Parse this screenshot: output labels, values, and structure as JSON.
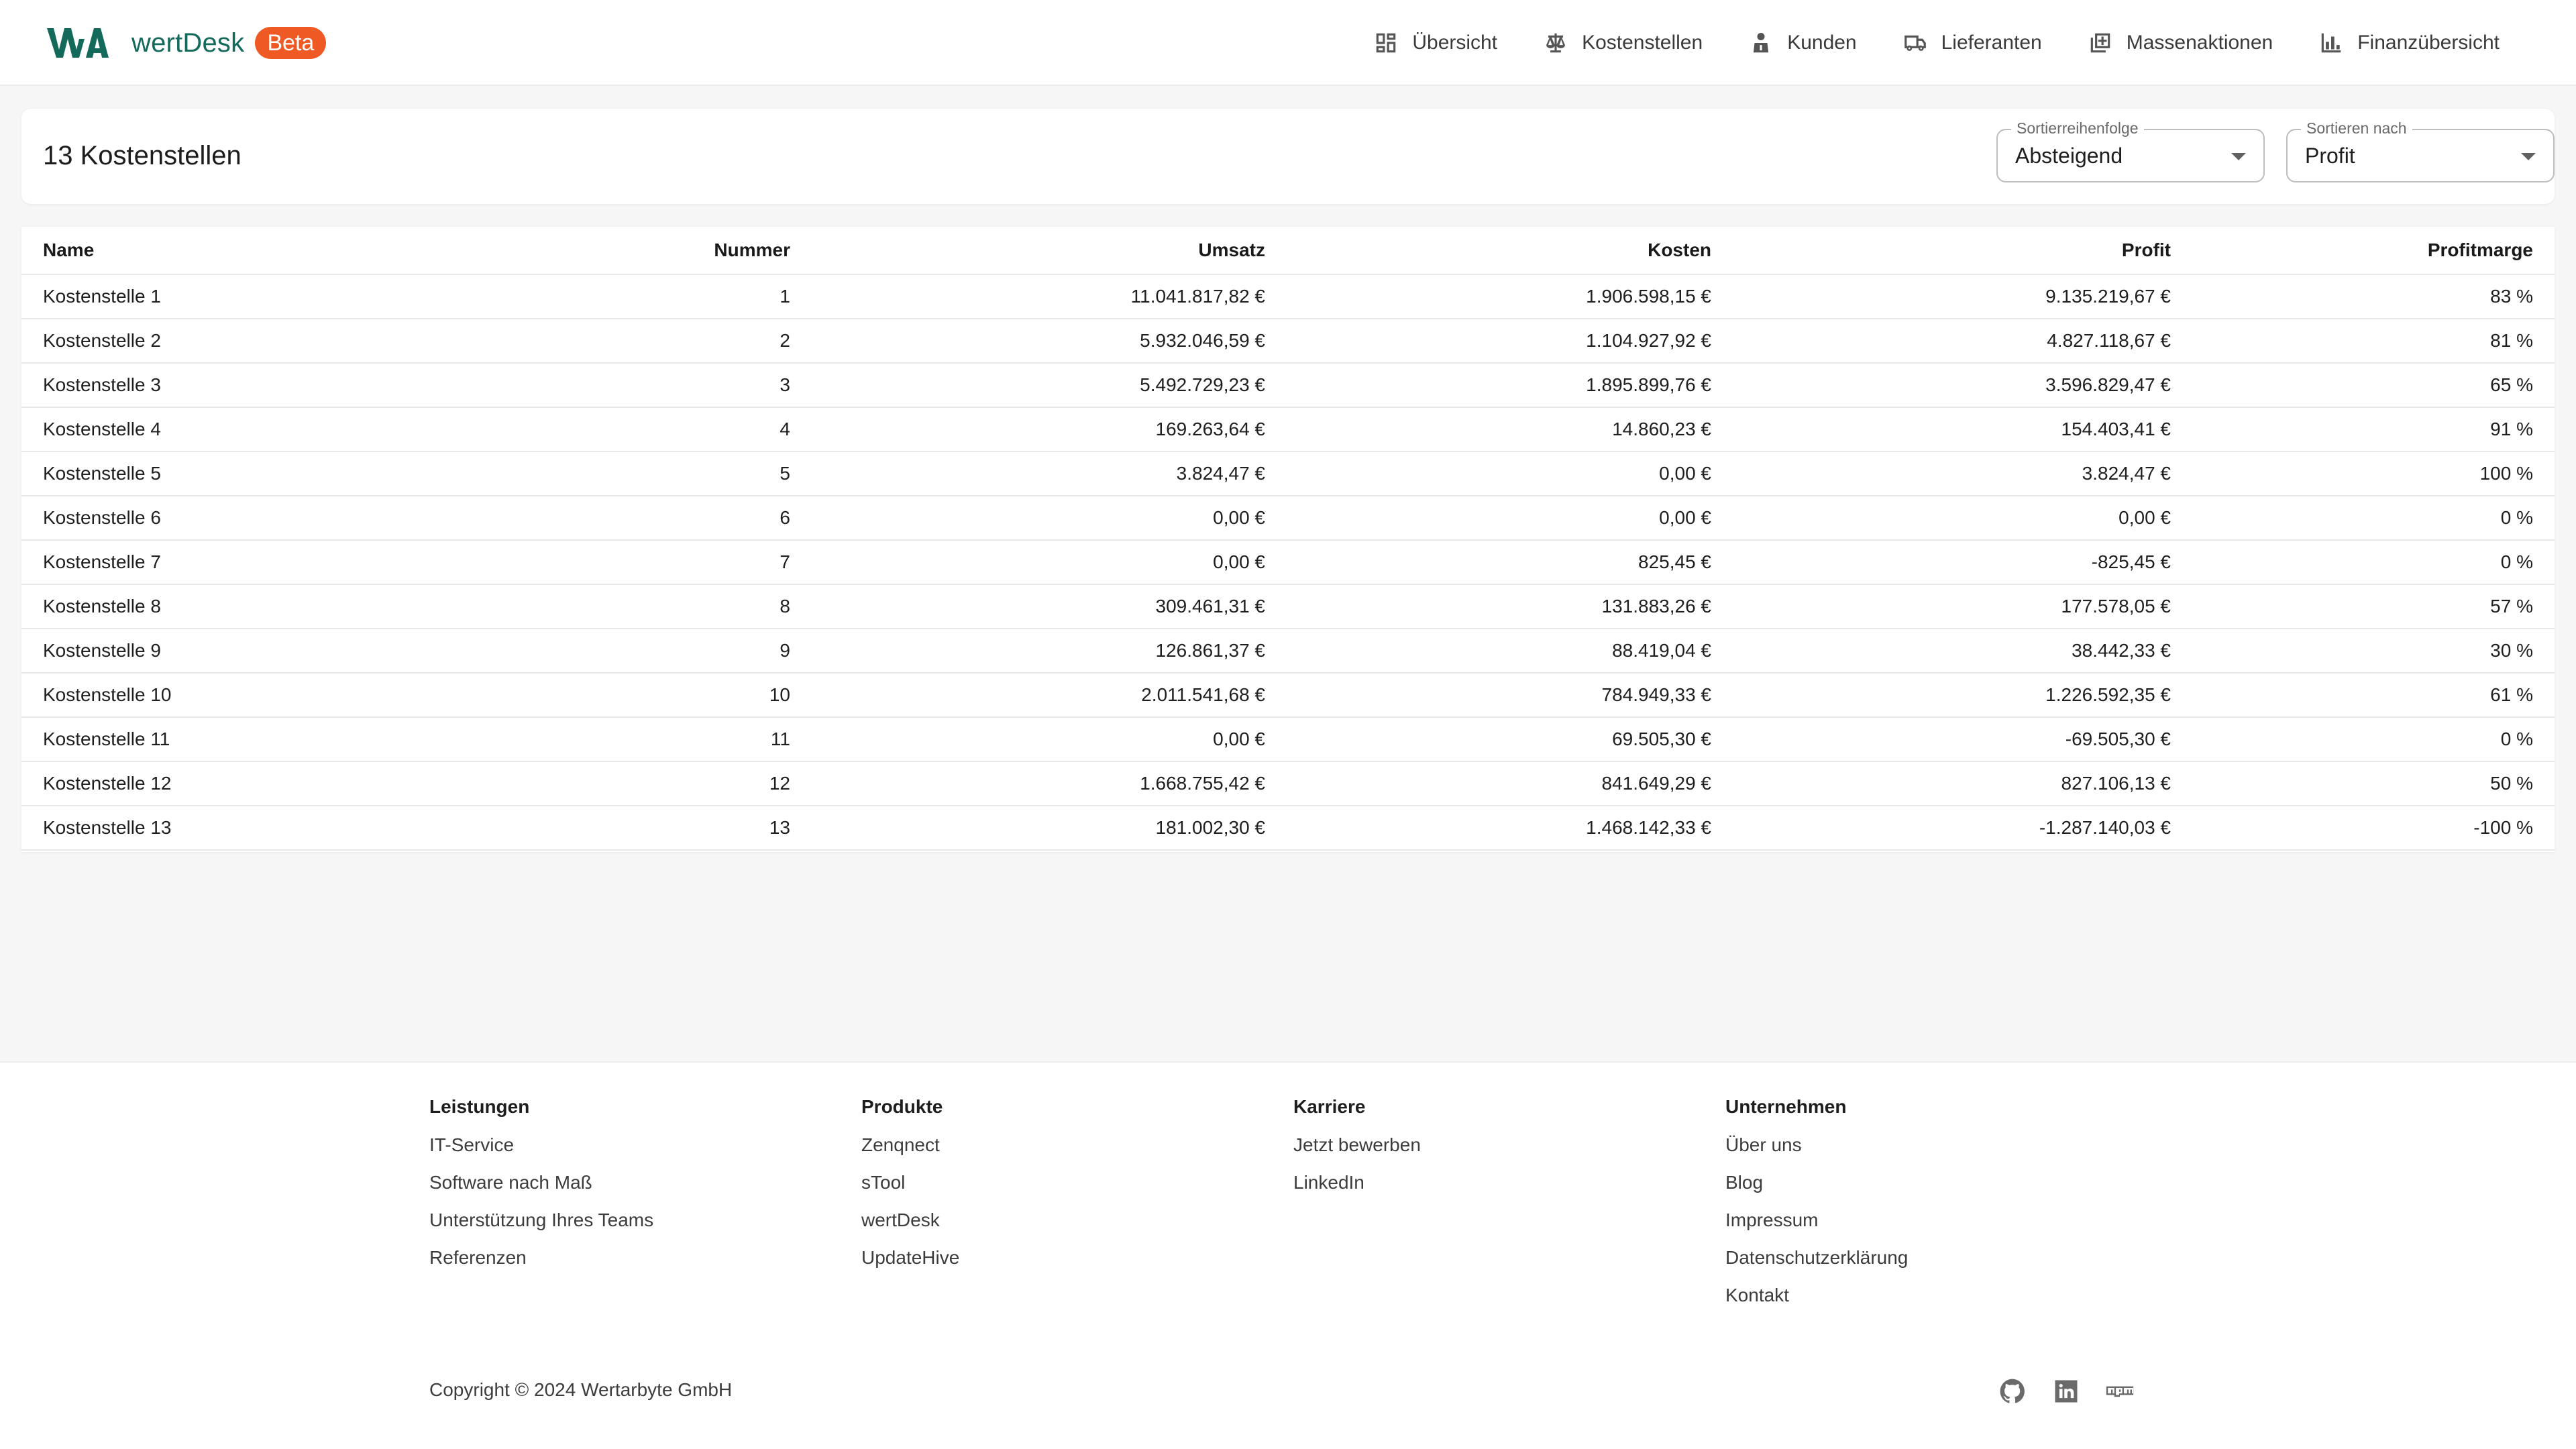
{
  "header": {
    "brand_name": "wertDesk",
    "beta_label": "Beta",
    "nav": [
      {
        "label": "Übersicht",
        "icon": "dashboard-icon"
      },
      {
        "label": "Kostenstellen",
        "icon": "scale-icon"
      },
      {
        "label": "Kunden",
        "icon": "person-icon"
      },
      {
        "label": "Lieferanten",
        "icon": "truck-icon"
      },
      {
        "label": "Massenaktionen",
        "icon": "add-box-icon"
      },
      {
        "label": "Finanzübersicht",
        "icon": "bar-chart-icon"
      }
    ]
  },
  "page": {
    "title": "13 Kostenstellen",
    "order_select": {
      "label": "Sortierreihenfolge",
      "value": "Absteigend"
    },
    "sort_select": {
      "label": "Sortieren nach",
      "value": "Profit"
    }
  },
  "table": {
    "headers": [
      "Name",
      "Nummer",
      "Umsatz",
      "Kosten",
      "Profit",
      "Profitmarge"
    ],
    "rows": [
      [
        "Kostenstelle 1",
        "1",
        "11.041.817,82 €",
        "1.906.598,15 €",
        "9.135.219,67 €",
        "83 %"
      ],
      [
        "Kostenstelle 2",
        "2",
        "5.932.046,59 €",
        "1.104.927,92 €",
        "4.827.118,67 €",
        "81 %"
      ],
      [
        "Kostenstelle 3",
        "3",
        "5.492.729,23 €",
        "1.895.899,76 €",
        "3.596.829,47 €",
        "65 %"
      ],
      [
        "Kostenstelle 4",
        "4",
        "169.263,64 €",
        "14.860,23 €",
        "154.403,41 €",
        "91 %"
      ],
      [
        "Kostenstelle 5",
        "5",
        "3.824,47 €",
        "0,00 €",
        "3.824,47 €",
        "100 %"
      ],
      [
        "Kostenstelle 6",
        "6",
        "0,00 €",
        "0,00 €",
        "0,00 €",
        "0 %"
      ],
      [
        "Kostenstelle 7",
        "7",
        "0,00 €",
        "825,45 €",
        "-825,45 €",
        "0 %"
      ],
      [
        "Kostenstelle 8",
        "8",
        "309.461,31 €",
        "131.883,26 €",
        "177.578,05 €",
        "57 %"
      ],
      [
        "Kostenstelle 9",
        "9",
        "126.861,37 €",
        "88.419,04 €",
        "38.442,33 €",
        "30 %"
      ],
      [
        "Kostenstelle 10",
        "10",
        "2.011.541,68 €",
        "784.949,33 €",
        "1.226.592,35 €",
        "61 %"
      ],
      [
        "Kostenstelle 11",
        "11",
        "0,00 €",
        "69.505,30 €",
        "-69.505,30 €",
        "0 %"
      ],
      [
        "Kostenstelle 12",
        "12",
        "1.668.755,42 €",
        "841.649,29 €",
        "827.106,13 €",
        "50 %"
      ],
      [
        "Kostenstelle 13",
        "13",
        "181.002,30 €",
        "1.468.142,33 €",
        "-1.287.140,03 €",
        "-100 %"
      ]
    ]
  },
  "footer": {
    "columns": [
      {
        "title": "Leistungen",
        "links": [
          "IT-Service",
          "Software nach Maß",
          "Unterstützung Ihres Teams",
          "Referenzen"
        ]
      },
      {
        "title": "Produkte",
        "links": [
          "Zenqnect",
          "sTool",
          "wertDesk",
          "UpdateHive"
        ]
      },
      {
        "title": "Karriere",
        "links": [
          "Jetzt bewerben",
          "LinkedIn"
        ]
      },
      {
        "title": "Unternehmen",
        "links": [
          "Über uns",
          "Blog",
          "Impressum",
          "Datenschutzerklärung",
          "Kontakt"
        ]
      }
    ],
    "copyright": "Copyright © 2024 Wertarbyte GmbH",
    "social": [
      "github-icon",
      "linkedin-icon",
      "npm-icon"
    ]
  },
  "colors": {
    "brand": "#13695a",
    "beta": "#ef5a24",
    "background": "#f6f6f6"
  }
}
